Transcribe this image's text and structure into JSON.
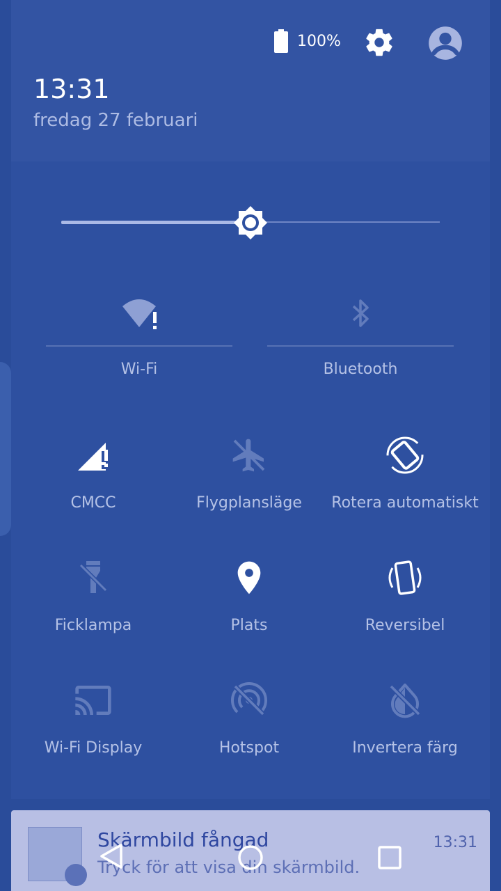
{
  "status": {
    "battery_level": "100%",
    "battery_fraction": 1.0
  },
  "header": {
    "time": "13:31",
    "date": "fredag 27 februari"
  },
  "brightness": {
    "level": 0.5
  },
  "tiles_big": [
    {
      "label": "Wi-Fi",
      "icon": "wifi-alert-icon",
      "state": "on"
    },
    {
      "label": "Bluetooth",
      "icon": "bluetooth-icon",
      "state": "off"
    }
  ],
  "tiles": [
    {
      "label": "CMCC",
      "icon": "signal-alert-icon",
      "state": "on"
    },
    {
      "label": "Flygplansläge",
      "icon": "airplane-icon",
      "state": "off"
    },
    {
      "label": "Rotera automatiskt",
      "icon": "rotate-icon",
      "state": "on"
    },
    {
      "label": "Ficklampa",
      "icon": "flashlight-off-icon",
      "state": "off"
    },
    {
      "label": "Plats",
      "icon": "location-icon",
      "state": "on"
    },
    {
      "label": "Reversibel",
      "icon": "reversible-icon",
      "state": "on"
    },
    {
      "label": "Wi-Fi Display",
      "icon": "cast-icon",
      "state": "off"
    },
    {
      "label": "Hotspot",
      "icon": "hotspot-off-icon",
      "state": "off"
    },
    {
      "label": "Invertera färg",
      "icon": "invert-colors-off-icon",
      "state": "off"
    }
  ],
  "notification": {
    "title": "Skärmbild fångad",
    "text": "Tryck för att visa din skärmbild.",
    "time": "13:31"
  },
  "colors": {
    "background": "#2a4c9a",
    "panel": "#2e50a0",
    "header": "#3354a3",
    "notification": "#b8bfe4"
  }
}
